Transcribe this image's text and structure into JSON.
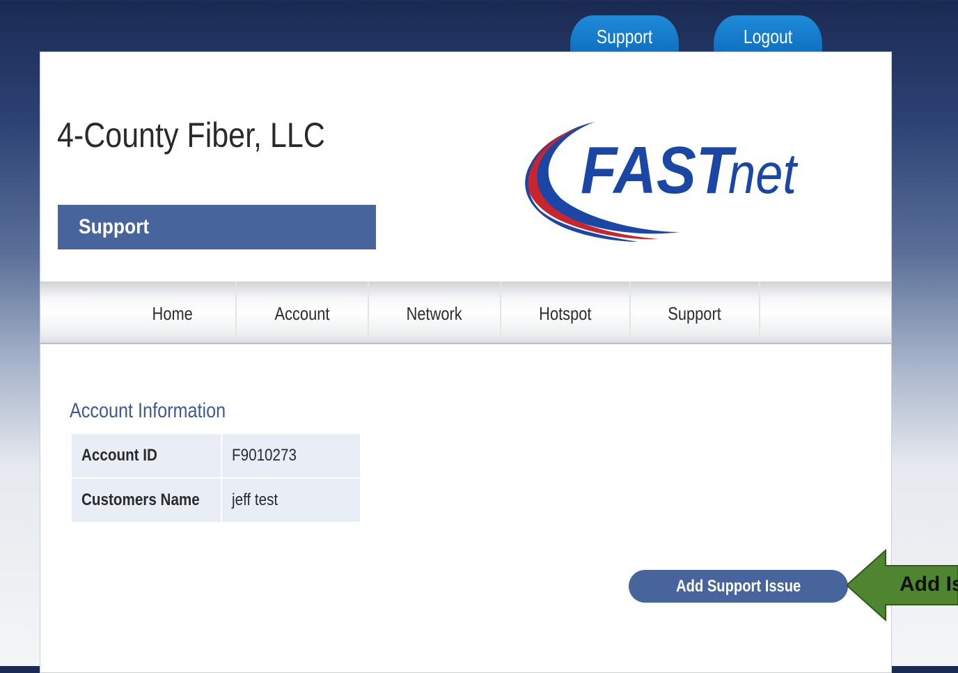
{
  "top_tabs": {
    "support": "Support",
    "logout": "Logout"
  },
  "header": {
    "company_name": "4-County Fiber, LLC",
    "section_title": "Support"
  },
  "logo": {
    "brand_bold": "FAST",
    "brand_light": "net"
  },
  "nav": {
    "items": [
      "Home",
      "Account",
      "Network",
      "Hotspot",
      "Support"
    ]
  },
  "account_info": {
    "heading": "Account Information",
    "rows": [
      {
        "label": "Account ID",
        "value": "F9010273"
      },
      {
        "label": "Customers Name",
        "value": "jeff test"
      }
    ]
  },
  "actions": {
    "add_support_issue": "Add Support Issue"
  },
  "callout": {
    "text": "Add Is",
    "color": "#4f8530"
  },
  "colors": {
    "banner": "#47659c",
    "tab": "#0e6fc0",
    "logo_blue": "#1a47a6",
    "logo_red": "#c8262f"
  }
}
